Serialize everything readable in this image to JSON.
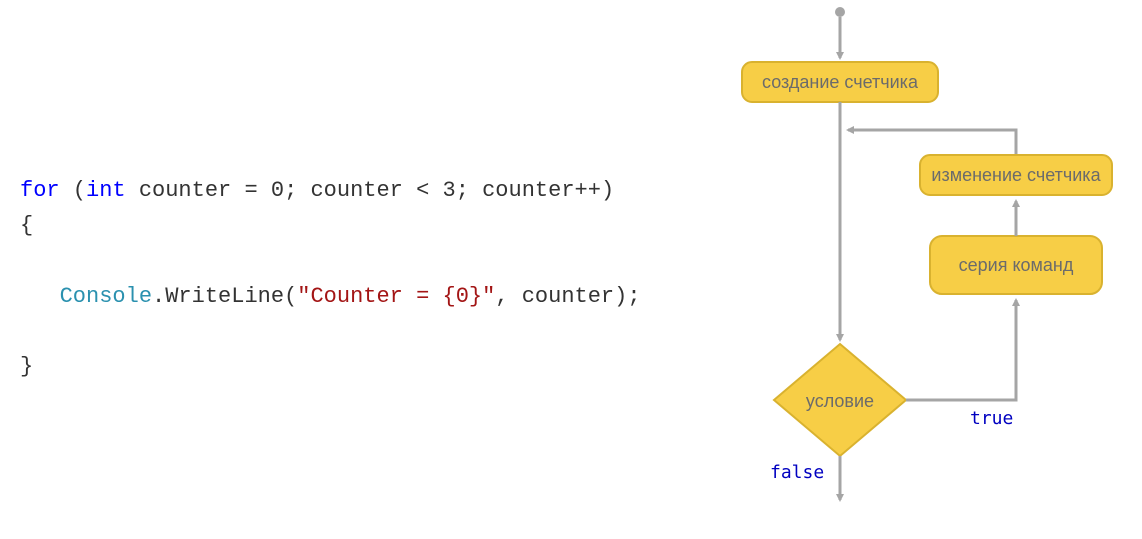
{
  "code": {
    "kw_for": "for",
    "kw_int": "int",
    "var_decl": "counter = 0",
    "cond": "counter < 3",
    "incr": "counter++",
    "open_brace": "{",
    "console_cls": "Console",
    "method_call": ".WriteLine(",
    "string_lit": "\"Counter = {0}\"",
    "args_rest": ", counter);",
    "close_brace": "}"
  },
  "diagram": {
    "node_init": "создание счетчика",
    "node_change": "изменение счетчика",
    "node_cmds": "серия команд",
    "node_cond": "условие",
    "label_true": "true",
    "label_false": "false"
  }
}
